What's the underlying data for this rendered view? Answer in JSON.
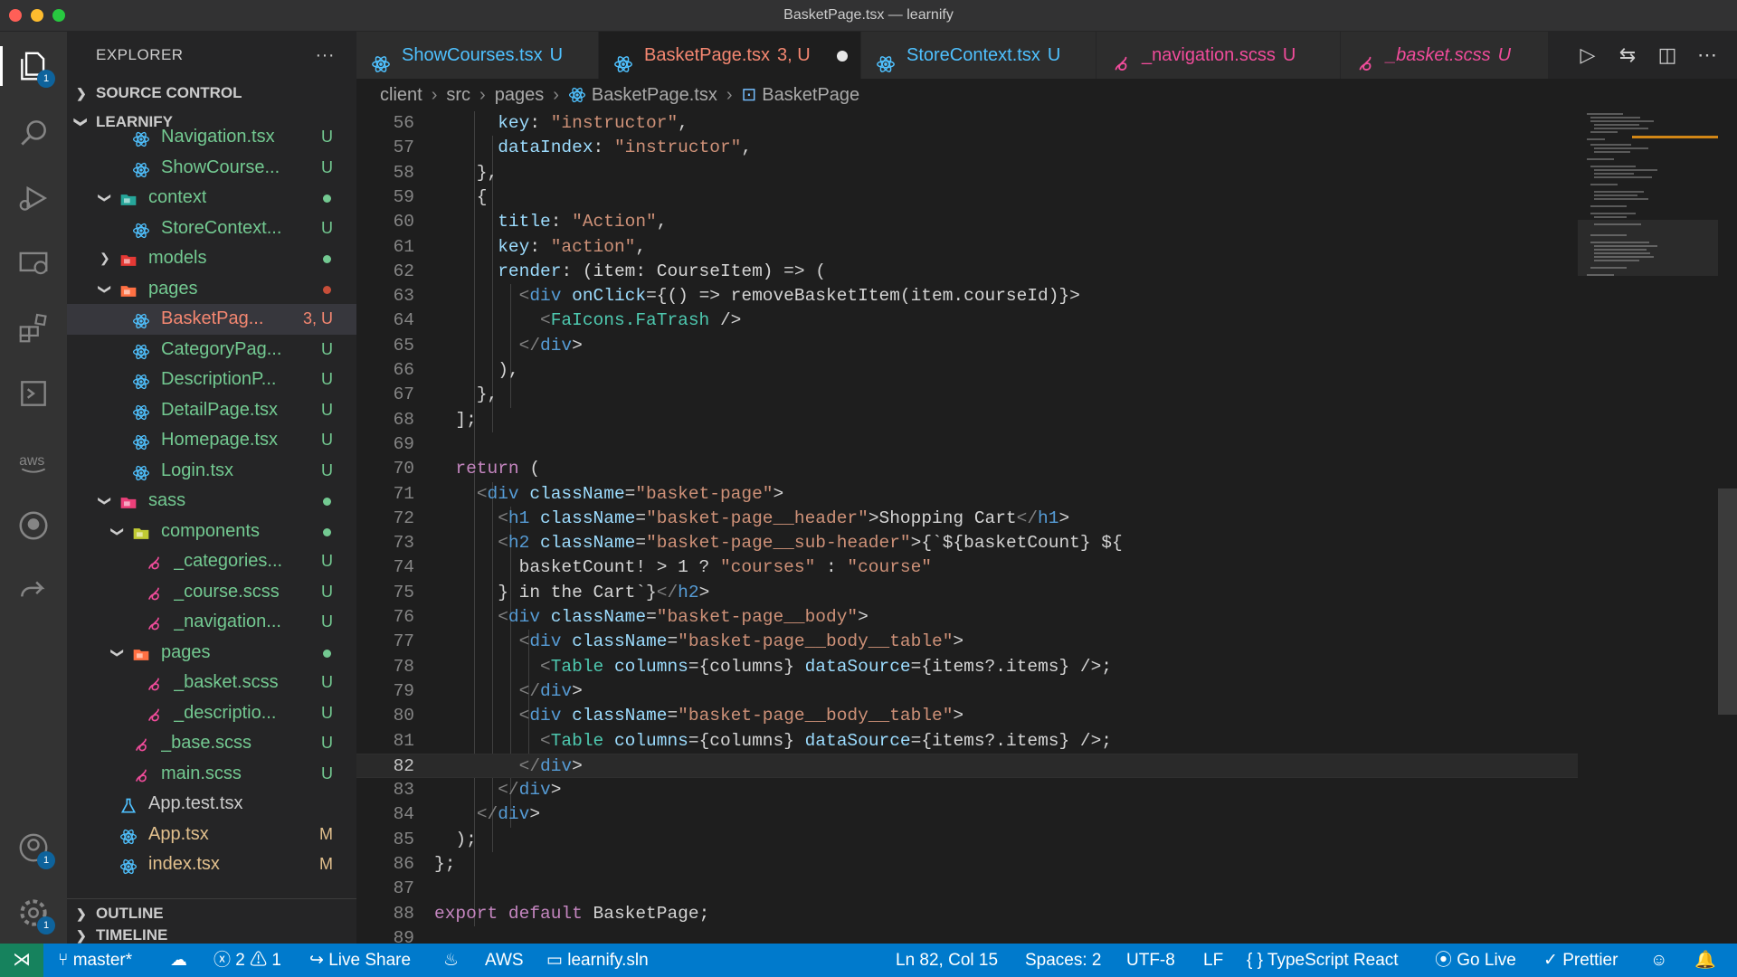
{
  "window": {
    "title": "BasketPage.tsx — learnify"
  },
  "activity_bar": {
    "items": [
      {
        "icon": "files-icon",
        "badge": "1"
      },
      {
        "icon": "search-icon",
        "badge": ""
      },
      {
        "icon": "run-debug-icon",
        "badge": ""
      },
      {
        "icon": "remote-explorer-icon",
        "badge": ""
      },
      {
        "icon": "extensions-icon",
        "badge": ""
      },
      {
        "icon": "terminal-icon",
        "badge": ""
      },
      {
        "icon": "aws-icon",
        "badge": ""
      },
      {
        "icon": "github-icon",
        "badge": ""
      },
      {
        "icon": "live-share-icon",
        "badge": ""
      }
    ],
    "bottom": [
      {
        "icon": "accounts-icon",
        "badge": "1"
      },
      {
        "icon": "manage-gear-icon",
        "badge": "1"
      }
    ],
    "aws_label": "aws"
  },
  "sidebar": {
    "title": "EXPLORER",
    "more": "···",
    "source_control": "SOURCE CONTROL",
    "root": "LEARNIFY",
    "outline": "OUTLINE",
    "timeline": "TIMELINE",
    "items": [
      {
        "label": "Navigation.tsx",
        "status": "U",
        "kind": "react",
        "depth": 2,
        "chev": ""
      },
      {
        "label": "ShowCourse...",
        "status": "U",
        "kind": "react",
        "depth": 2,
        "chev": ""
      },
      {
        "label": "context",
        "status": "",
        "kind": "folder-green",
        "depth": 1,
        "chev": "v",
        "dot": "#73c991"
      },
      {
        "label": "StoreContext...",
        "status": "U",
        "kind": "react",
        "depth": 2,
        "chev": ""
      },
      {
        "label": "models",
        "status": "",
        "kind": "folder-red",
        "depth": 1,
        "chev": ">",
        "dot": "#73c991"
      },
      {
        "label": "pages",
        "status": "",
        "kind": "folder-orange",
        "depth": 1,
        "chev": "v",
        "dot": "#c74e39"
      },
      {
        "label": "BasketPag...",
        "status": "3, U",
        "kind": "react",
        "depth": 2,
        "chev": "",
        "selected": true,
        "color": "#f48771"
      },
      {
        "label": "CategoryPag...",
        "status": "U",
        "kind": "react",
        "depth": 2,
        "chev": ""
      },
      {
        "label": "DescriptionP...",
        "status": "U",
        "kind": "react",
        "depth": 2,
        "chev": ""
      },
      {
        "label": "DetailPage.tsx",
        "status": "U",
        "kind": "react",
        "depth": 2,
        "chev": ""
      },
      {
        "label": "Homepage.tsx",
        "status": "U",
        "kind": "react",
        "depth": 2,
        "chev": ""
      },
      {
        "label": "Login.tsx",
        "status": "U",
        "kind": "react",
        "depth": 2,
        "chev": ""
      },
      {
        "label": "sass",
        "status": "",
        "kind": "folder-pink",
        "depth": 1,
        "chev": "v",
        "dot": "#73c991"
      },
      {
        "label": "components",
        "status": "",
        "kind": "folder-yellow",
        "depth": 2,
        "chev": "v",
        "dot": "#73c991"
      },
      {
        "label": "_categories...",
        "status": "U",
        "kind": "sass",
        "depth": 3,
        "chev": ""
      },
      {
        "label": "_course.scss",
        "status": "U",
        "kind": "sass",
        "depth": 3,
        "chev": ""
      },
      {
        "label": "_navigation...",
        "status": "U",
        "kind": "sass",
        "depth": 3,
        "chev": ""
      },
      {
        "label": "pages",
        "status": "",
        "kind": "folder-orange",
        "depth": 2,
        "chev": "v",
        "dot": "#73c991"
      },
      {
        "label": "_basket.scss",
        "status": "U",
        "kind": "sass",
        "depth": 3,
        "chev": ""
      },
      {
        "label": "_descriptio...",
        "status": "U",
        "kind": "sass",
        "depth": 3,
        "chev": ""
      },
      {
        "label": "_base.scss",
        "status": "U",
        "kind": "sass",
        "depth": 2,
        "chev": ""
      },
      {
        "label": "main.scss",
        "status": "U",
        "kind": "sass",
        "depth": 2,
        "chev": ""
      },
      {
        "label": "App.test.tsx",
        "status": "",
        "kind": "test",
        "depth": 1,
        "chev": ""
      },
      {
        "label": "App.tsx",
        "status": "M",
        "kind": "react",
        "depth": 1,
        "chev": "",
        "color": "#e2c08d"
      },
      {
        "label": "index.tsx",
        "status": "M",
        "kind": "react",
        "depth": 1,
        "chev": "",
        "color": "#e2c08d"
      }
    ]
  },
  "tabs": [
    {
      "label": "ShowCourses.tsx",
      "status": "U",
      "kind": "react",
      "active": false,
      "dirty": false
    },
    {
      "label": "BasketPage.tsx",
      "status": "3, U",
      "kind": "react",
      "active": true,
      "dirty": true
    },
    {
      "label": "StoreContext.tsx",
      "status": "U",
      "kind": "react",
      "active": false,
      "dirty": false
    },
    {
      "label": "_navigation.scss",
      "status": "U",
      "kind": "sass",
      "active": false,
      "dirty": false
    },
    {
      "label": "_basket.scss",
      "status": "U",
      "kind": "sass",
      "active": false,
      "dirty": false
    }
  ],
  "tab_toolbar": [
    "run-icon",
    "compare-changes-icon",
    "split-editor-icon",
    "more-actions-icon"
  ],
  "breadcrumb": [
    "client",
    "src",
    "pages",
    "BasketPage.tsx",
    "BasketPage"
  ],
  "editor": {
    "current_line": 82,
    "lines": [
      {
        "n": "56",
        "t": "      key: \"instructor\","
      },
      {
        "n": "57",
        "t": "      dataIndex: \"instructor\","
      },
      {
        "n": "58",
        "t": "    },"
      },
      {
        "n": "59",
        "t": "    {"
      },
      {
        "n": "60",
        "t": "      title: \"Action\","
      },
      {
        "n": "61",
        "t": "      key: \"action\","
      },
      {
        "n": "62",
        "t": "      render: (item: CourseItem) => ("
      },
      {
        "n": "63",
        "t": "        <div onClick={() => removeBasketItem(item.courseId)}>"
      },
      {
        "n": "64",
        "t": "          <FaIcons.FaTrash />"
      },
      {
        "n": "65",
        "t": "        </div>"
      },
      {
        "n": "66",
        "t": "      ),"
      },
      {
        "n": "67",
        "t": "    },"
      },
      {
        "n": "68",
        "t": "  ];"
      },
      {
        "n": "69",
        "t": ""
      },
      {
        "n": "70",
        "t": "  return ("
      },
      {
        "n": "71",
        "t": "    <div className=\"basket-page\">"
      },
      {
        "n": "72",
        "t": "      <h1 className=\"basket-page__header\">Shopping Cart</h1>"
      },
      {
        "n": "73",
        "t": "      <h2 className=\"basket-page__sub-header\">{`${basketCount} ${"
      },
      {
        "n": "74",
        "t": "        basketCount! > 1 ? \"courses\" : \"course\""
      },
      {
        "n": "75",
        "t": "      } in the Cart`}</h2>"
      },
      {
        "n": "76",
        "t": "      <div className=\"basket-page__body\">"
      },
      {
        "n": "77",
        "t": "        <div className=\"basket-page__body__table\">"
      },
      {
        "n": "78",
        "t": "          <Table columns={columns} dataSource={items?.items} />;"
      },
      {
        "n": "79",
        "t": "        </div>"
      },
      {
        "n": "80",
        "t": "        <div className=\"basket-page__body__table\">"
      },
      {
        "n": "81",
        "t": "          <Table columns={columns} dataSource={items?.items} />;"
      },
      {
        "n": "82",
        "t": "        </div>"
      },
      {
        "n": "83",
        "t": "      </div>"
      },
      {
        "n": "84",
        "t": "    </div>"
      },
      {
        "n": "85",
        "t": "  );"
      },
      {
        "n": "86",
        "t": "};"
      },
      {
        "n": "87",
        "t": ""
      },
      {
        "n": "88",
        "t": "export default BasketPage;"
      },
      {
        "n": "89",
        "t": ""
      }
    ]
  },
  "statusbar": {
    "branch": "master*",
    "errors": "2",
    "warnings": "1",
    "live_share": "Live Share",
    "aws": "AWS",
    "solution": "learnify.sln",
    "position": "Ln 82, Col 15",
    "spaces": "Spaces: 2",
    "encoding": "UTF-8",
    "eol": "LF",
    "language": "TypeScript React",
    "go_live": "Go Live",
    "prettier": "Prettier"
  },
  "colors": {
    "react": "#4fc1ff",
    "sass": "#f14c9b",
    "untracked": "#73c991",
    "modified": "#e2c08d",
    "error": "#f48771",
    "status_bg": "#007acc"
  }
}
